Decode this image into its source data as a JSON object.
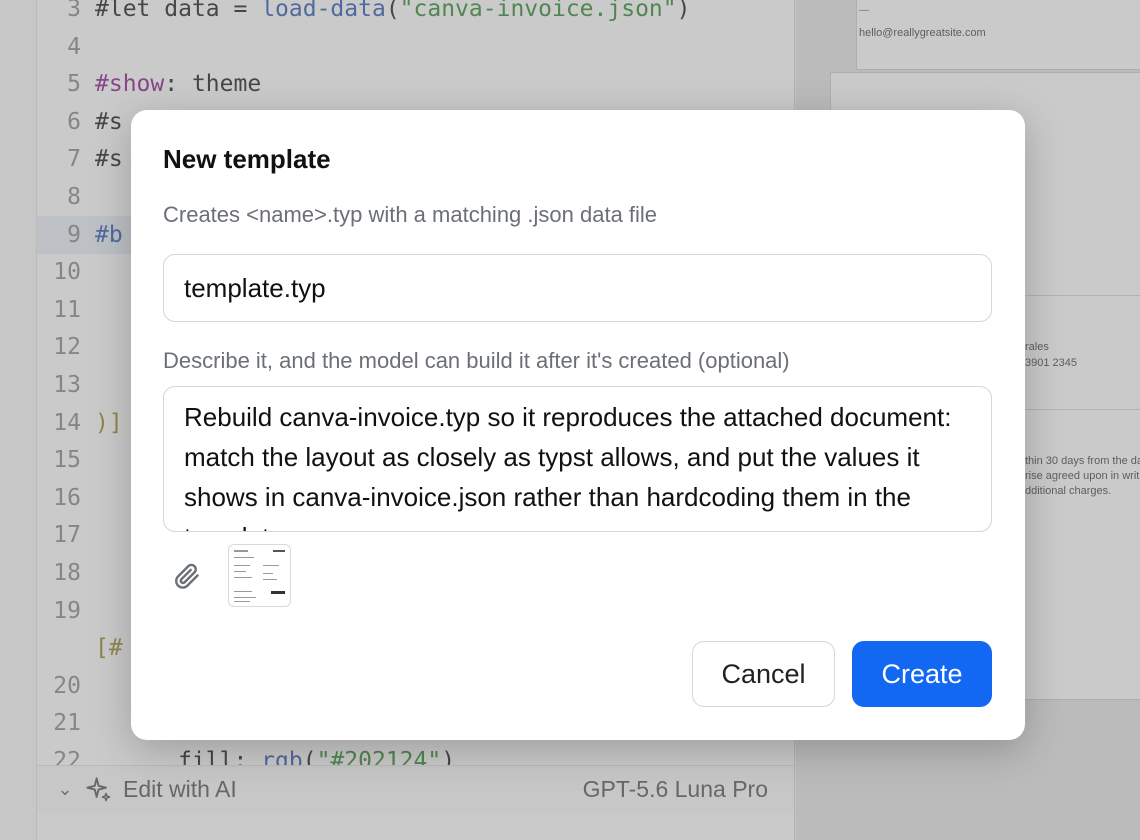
{
  "editor": {
    "lines": [
      {
        "n": "3",
        "parts": [
          [
            "#let ",
            "hash"
          ],
          [
            "data",
            "plain"
          ],
          [
            " = ",
            "plain"
          ],
          [
            "load-data",
            "fn"
          ],
          [
            "(",
            "plain"
          ],
          [
            "\"canva-invoice.json\"",
            "str"
          ],
          [
            ")",
            "plain"
          ]
        ]
      },
      {
        "n": "4",
        "parts": []
      },
      {
        "n": "5",
        "parts": [
          [
            "#show",
            "kw"
          ],
          [
            ": theme",
            "plain"
          ]
        ]
      },
      {
        "n": "6",
        "parts": [
          [
            "#s",
            "hash"
          ]
        ]
      },
      {
        "n": "7",
        "parts": [
          [
            "#s",
            "hash"
          ]
        ]
      },
      {
        "n": "8",
        "parts": []
      },
      {
        "n": "9",
        "parts": [
          [
            "#b",
            "fn"
          ]
        ],
        "highlight": true
      },
      {
        "n": "10",
        "parts": []
      },
      {
        "n": "11",
        "parts": []
      },
      {
        "n": "12",
        "parts": []
      },
      {
        "n": "13",
        "parts": []
      },
      {
        "n": "14",
        "parts": [
          [
            ")]",
            "br"
          ]
        ]
      },
      {
        "n": "15",
        "parts": []
      },
      {
        "n": "16",
        "parts": []
      },
      {
        "n": "17",
        "parts": []
      },
      {
        "n": "18",
        "parts": []
      },
      {
        "n": "19",
        "parts": []
      },
      {
        "n": "",
        "parts": [
          [
            "[#",
            "br"
          ]
        ]
      },
      {
        "n": "20",
        "parts": []
      },
      {
        "n": "21",
        "parts": []
      },
      {
        "n": "22",
        "parts": [
          [
            "      fill: ",
            "plain"
          ],
          [
            "rgb",
            "fn"
          ],
          [
            "(",
            "plain"
          ],
          [
            "\"#202124\"",
            "str"
          ],
          [
            ")",
            "plain"
          ]
        ]
      }
    ],
    "bottom_bar": {
      "label": "Edit with AI",
      "model": "GPT-5.6 Luna Pro"
    }
  },
  "preview": {
    "email": "hello@reallygreatsite.com",
    "text_1": "rales",
    "text_2": "3901 2345",
    "text_3": "thin 30 days from the da",
    "text_4": "rise agreed upon in writi",
    "text_5": "dditional charges."
  },
  "dialog": {
    "title": "New template",
    "subtitle": "Creates <name>.typ with a matching .json data file",
    "name_value": "template.typ",
    "description_label": "Describe it, and the model can build it after it's created (optional)",
    "description_value": "Rebuild canva-invoice.typ so it reproduces the attached document: match the layout as closely as typst allows, and put the values it shows in canva-invoice.json rather than hardcoding them in the template.",
    "cancel_label": "Cancel",
    "create_label": "Create"
  },
  "colors": {
    "primary": "#1268f2",
    "keyword": "#8a1c8c",
    "string": "#2f8a2f",
    "function": "#2d5bb5"
  }
}
